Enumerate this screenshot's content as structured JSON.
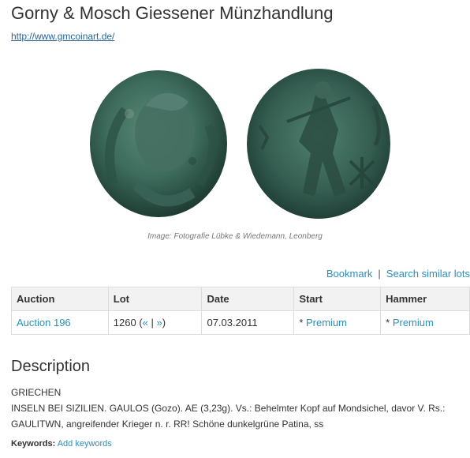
{
  "header": {
    "title": "Gorny & Mosch Giessener Münzhandlung",
    "website": "http://www.gmcoinart.de/"
  },
  "image": {
    "caption": "Image: Fotografie Lübke & Wiedemann, Leonberg"
  },
  "actions": {
    "bookmark": "Bookmark",
    "separator": "|",
    "search_similar": "Search similar lots"
  },
  "table": {
    "headers": [
      "Auction",
      "Lot",
      "Date",
      "Start",
      "Hammer"
    ],
    "row": {
      "auction": "Auction 196",
      "lot": "1260",
      "lot_nav_open": "(",
      "lot_prev": "«",
      "lot_nav_sep": "|",
      "lot_next": "»",
      "lot_nav_close": ")",
      "date": "07.03.2011",
      "start_prefix": "*",
      "start_link": "Premium",
      "hammer_prefix": "*",
      "hammer_link": "Premium"
    }
  },
  "description": {
    "heading": "Description",
    "line1": "GRIECHEN",
    "line2": "INSELN BEI SIZILIEN. GAULOS (Gozo). AE (3,23g). Vs.: Behelmter Kopf auf Mondsichel, davor V. Rs.: GAULITWN, angreifender Krieger n. r. RR! Schöne dunkelgrüne Patina, ss"
  },
  "keywords": {
    "label": "Keywords:",
    "add_link": "Add keywords"
  }
}
